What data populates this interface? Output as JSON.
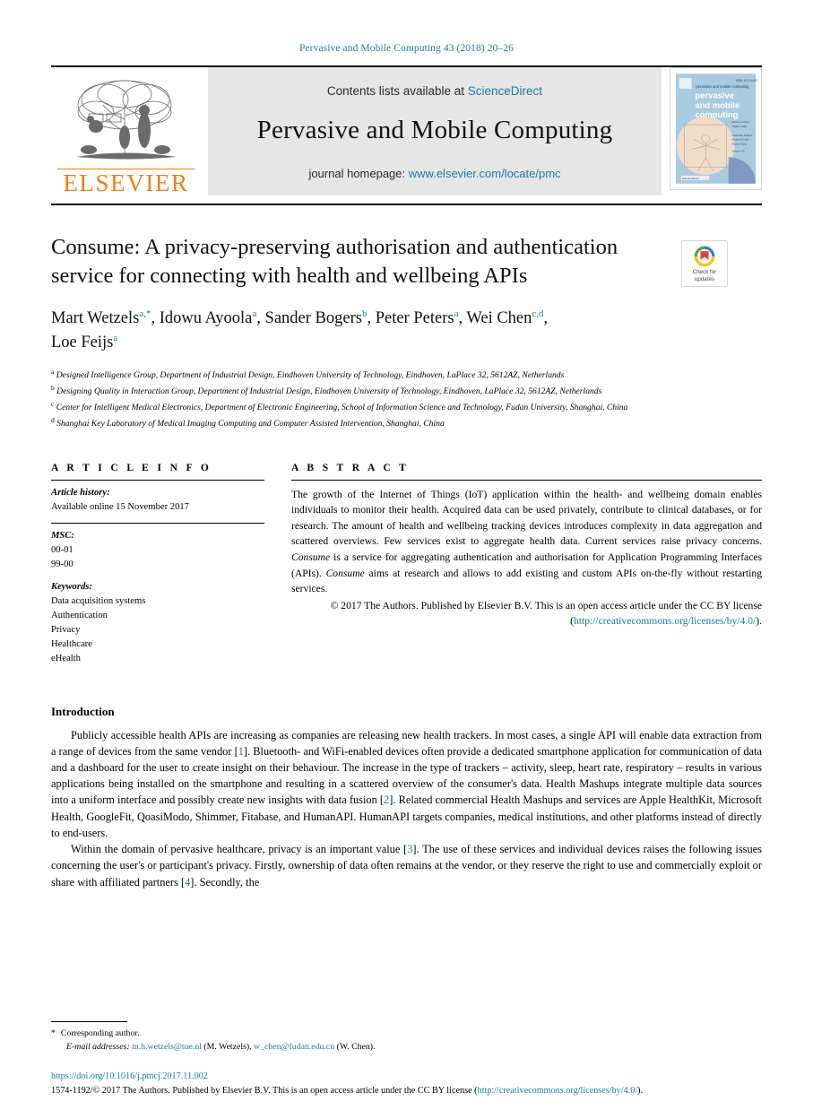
{
  "running_head": "Pervasive and Mobile Computing 43 (2018) 20–26",
  "masthead": {
    "publisher_name": "ELSEVIER",
    "contents_prefix": "Contents lists available at",
    "contents_link": "ScienceDirect",
    "journal_title": "Pervasive and Mobile Computing",
    "homepage_prefix": "journal homepage:",
    "homepage_link": "www.elsevier.com/locate/pmc",
    "cover_title_line1": "pervasive",
    "cover_title_line2": "and mobile",
    "cover_title_line3": "computing"
  },
  "crossmark": {
    "label_line1": "Check for",
    "label_line2": "updates",
    "colors": {
      "red": "#e8403a",
      "yellow": "#f5c518",
      "blue": "#2f7fd0",
      "green": "#4aa84a"
    }
  },
  "article": {
    "title": "Consume: A privacy-preserving authorisation and authentication service for connecting with health and wellbeing APIs",
    "authors_line1_parts": [
      {
        "name": "Mart Wetzels",
        "sup": "a,*"
      },
      {
        "name": "Idowu Ayoola",
        "sup": "a"
      },
      {
        "name": "Sander Bogers",
        "sup": "b"
      },
      {
        "name": "Peter Peters",
        "sup": "a"
      },
      {
        "name": "Wei Chen",
        "sup": "c,d"
      }
    ],
    "authors_line2": {
      "name": "Loe Feijs",
      "sup": "a"
    },
    "affiliations": [
      {
        "marker": "a",
        "text": "Designed Intelligence Group, Department of Industrial Design, Eindhoven University of Technology, Eindhoven, LaPlace 32, 5612AZ, Netherlands"
      },
      {
        "marker": "b",
        "text": "Designing Quality in Interaction Group, Department of Industrial Design, Eindhoven University of Technology, Eindhoven, LaPlace 32, 5612AZ, Netherlands"
      },
      {
        "marker": "c",
        "text": "Center for Intelligent Medical Electronics, Department of Electronic Engineering, School of Information Science and Technology, Fudan University, Shanghai, China"
      },
      {
        "marker": "d",
        "text": "Shanghai Key Laboratory of Medical Imaging Computing and Computer Assisted Intervention, Shanghai, China"
      }
    ]
  },
  "article_info": {
    "heading": "A R T I C L E   I N F O",
    "history_label": "Article history:",
    "history_value": "Available online 15 November 2017",
    "msc_label": "MSC:",
    "msc_codes": [
      "00-01",
      "99-00"
    ],
    "keywords_label": "Keywords:",
    "keywords": [
      "Data acquisition systems",
      "Authentication",
      "Privacy",
      "Healthcare",
      "eHealth"
    ]
  },
  "abstract": {
    "heading": "A B S T R A C T",
    "p1_a": "The growth of the Internet of Things (IoT) application within the health- and wellbeing domain enables individuals to monitor their health. Acquired data can be used privately, contribute to clinical databases, or for research. The amount of health and wellbeing tracking devices introduces complexity in data aggregation and scattered overviews. Few services exist to aggregate health data. Current services raise privacy concerns. ",
    "p1_em1": "Consume",
    "p1_b": " is a service for aggregating authentication and authorisation for Application Programming Interfaces (APIs). ",
    "p1_em2": "Consume",
    "p1_c": " aims at research and allows to add existing and custom APIs on-the-fly without restarting services.",
    "copyright": "© 2017 The Authors. Published by Elsevier B.V. This is an open access article under the CC BY license (",
    "copyright_link": "http://creativecommons.org/licenses/by/4.0/",
    "copyright_tail": ")."
  },
  "body": {
    "section_title": "Introduction",
    "p1_a": "Publicly accessible health APIs are increasing as companies are releasing new health trackers. In most cases, a single API will enable data extraction from a range of devices from the same vendor [",
    "p1_ref1": "1",
    "p1_b": "]. Bluetooth- and WiFi-enabled devices often provide a dedicated smartphone application for communication of data and a dashboard for the user to create insight on their behaviour. The increase in the type of trackers – activity, sleep, heart rate, respiratory – results in various applications being installed on the smartphone and resulting in a scattered overview of the consumer's data. Health Mashups integrate multiple data sources into a uniform interface and possibly create new insights with data fusion [",
    "p1_ref2": "2",
    "p1_c": "]. Related commercial Health Mashups and services are Apple HealthKit, Microsoft Health, GoogleFit, QoasiModo, Shimmer, Fitabase, and HumanAPI. HumanAPI targets companies, medical institutions, and other platforms  instead of directly to end-users.",
    "p2_a": "Within the domain of pervasive healthcare, privacy is an important value [",
    "p2_ref1": "3",
    "p2_b": "]. The use of these services and individual devices raises the following issues concerning the user's or participant's privacy. Firstly, ownership of data often remains at the vendor, or they reserve the right to use and commercially exploit or share with affiliated partners [",
    "p2_ref2": "4",
    "p2_c": "]. Secondly, the"
  },
  "footnotes": {
    "corresponding_marker": "*",
    "corresponding_text": "Corresponding author.",
    "email_label": "E-mail addresses:",
    "email1": "m.h.wetzels@tue.nl",
    "email1_owner": "(M. Wetzels),",
    "email2": "w_chen@fudan.edu.cn",
    "email2_owner": "(W. Chen)."
  },
  "doi_footer": {
    "doi": "https://doi.org/10.1016/j.pmcj.2017.11.002",
    "issn_line_a": "1574-1192/© 2017 The Authors. Published by Elsevier B.V. This is an open access article under the CC BY license (",
    "issn_link": "http://creativecommons.org/licenses/by/4.0/",
    "issn_line_b": ")."
  },
  "colors": {
    "link": "#1a7ba8",
    "elsevier_orange": "#f07f13",
    "banner_bg": "#e6e6e6"
  }
}
